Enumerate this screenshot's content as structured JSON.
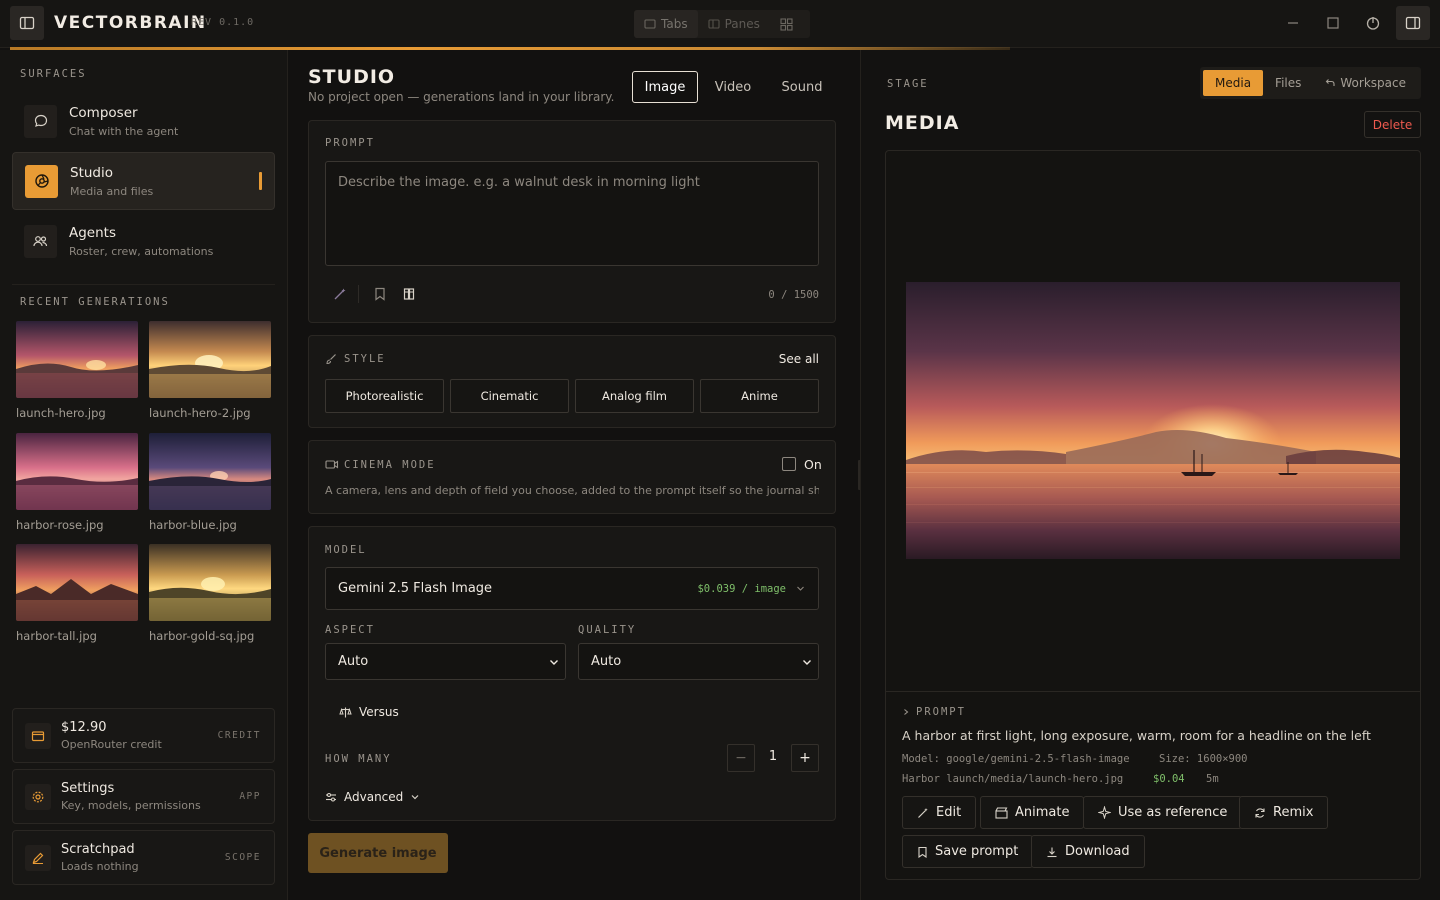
{
  "app": {
    "brand": "VECTORBRAIN",
    "revision": "REV 0.1.0",
    "view_modes": [
      {
        "label": "Tabs",
        "icon": "tab-icon"
      },
      {
        "label": "Panes",
        "icon": "panes-icon"
      }
    ]
  },
  "sidebar": {
    "surfaces_title": "SURFACES",
    "items": [
      {
        "title": "Composer",
        "subtitle": "Chat with the agent",
        "icon": "chat-icon"
      },
      {
        "title": "Studio",
        "subtitle": "Media and files",
        "icon": "aperture-icon"
      },
      {
        "title": "Agents",
        "subtitle": "Roster, crew, automations",
        "icon": "users-icon"
      }
    ],
    "recent_title": "RECENT GENERATIONS",
    "recent": [
      {
        "name": "launch-hero.jpg"
      },
      {
        "name": "launch-hero-2.jpg"
      },
      {
        "name": "harbor-rose.jpg"
      },
      {
        "name": "harbor-blue.jpg"
      },
      {
        "name": "harbor-tall.jpg"
      },
      {
        "name": "harbor-gold-sq.jpg"
      }
    ],
    "cards": [
      {
        "title": "$12.90",
        "subtitle": "OpenRouter credit",
        "tag": "CREDIT",
        "icon": "wallet-icon"
      },
      {
        "title": "Settings",
        "subtitle": "Key, models, permissions",
        "tag": "APP",
        "icon": "gear-icon"
      },
      {
        "title": "Scratchpad",
        "subtitle": "Loads nothing",
        "tag": "SCOPE",
        "icon": "pencil-icon"
      }
    ]
  },
  "studio": {
    "title": "STUDIO",
    "subtitle": "No project open — generations land in your library.",
    "tabs": [
      "Image",
      "Video",
      "Sound"
    ],
    "prompt": {
      "label": "PROMPT",
      "placeholder": "Describe the image. e.g. a walnut desk in morning light",
      "counter": "0 / 1500"
    },
    "style": {
      "label": "STYLE",
      "see_all": "See all",
      "options": [
        "Photorealistic",
        "Cinematic",
        "Analog film",
        "Anime"
      ]
    },
    "cinema": {
      "label": "CINEMA MODE",
      "toggle_label": "On",
      "description": "A camera, lens and depth of field you choose, added to the prompt itself so the journal shows..."
    },
    "model": {
      "label": "MODEL",
      "name": "Gemini 2.5 Flash Image",
      "price": "$0.039 / image"
    },
    "aspect": {
      "label": "ASPECT",
      "value": "Auto"
    },
    "quality": {
      "label": "QUALITY",
      "value": "Auto"
    },
    "versus_label": "Versus",
    "how_many": {
      "label": "HOW MANY",
      "value": "1",
      "minus": "−",
      "plus": "+"
    },
    "advanced_label": "Advanced",
    "generate_label": "Generate image"
  },
  "stage": {
    "label": "STAGE",
    "tabs": [
      "Media",
      "Files",
      "Workspace"
    ],
    "title": "MEDIA",
    "delete_label": "Delete",
    "prompt_label": "PROMPT",
    "prompt_text": "A harbor at first light, long exposure, warm, room for a headline on the left",
    "model_line": "Model: google/gemini-2.5-flash-image",
    "size_line": "Size: 1600×900",
    "path_line": "Harbor launch/media/launch-hero.jpg",
    "cost": "$0.04",
    "age": "5m",
    "actions": [
      "Edit",
      "Animate",
      "Use as reference",
      "Remix",
      "Save prompt",
      "Download"
    ]
  },
  "colors": {
    "accent": "#e89b35",
    "background": "#121110",
    "panel": "#181715",
    "danger": "#ef5a4f",
    "price": "#7fbf6a"
  }
}
